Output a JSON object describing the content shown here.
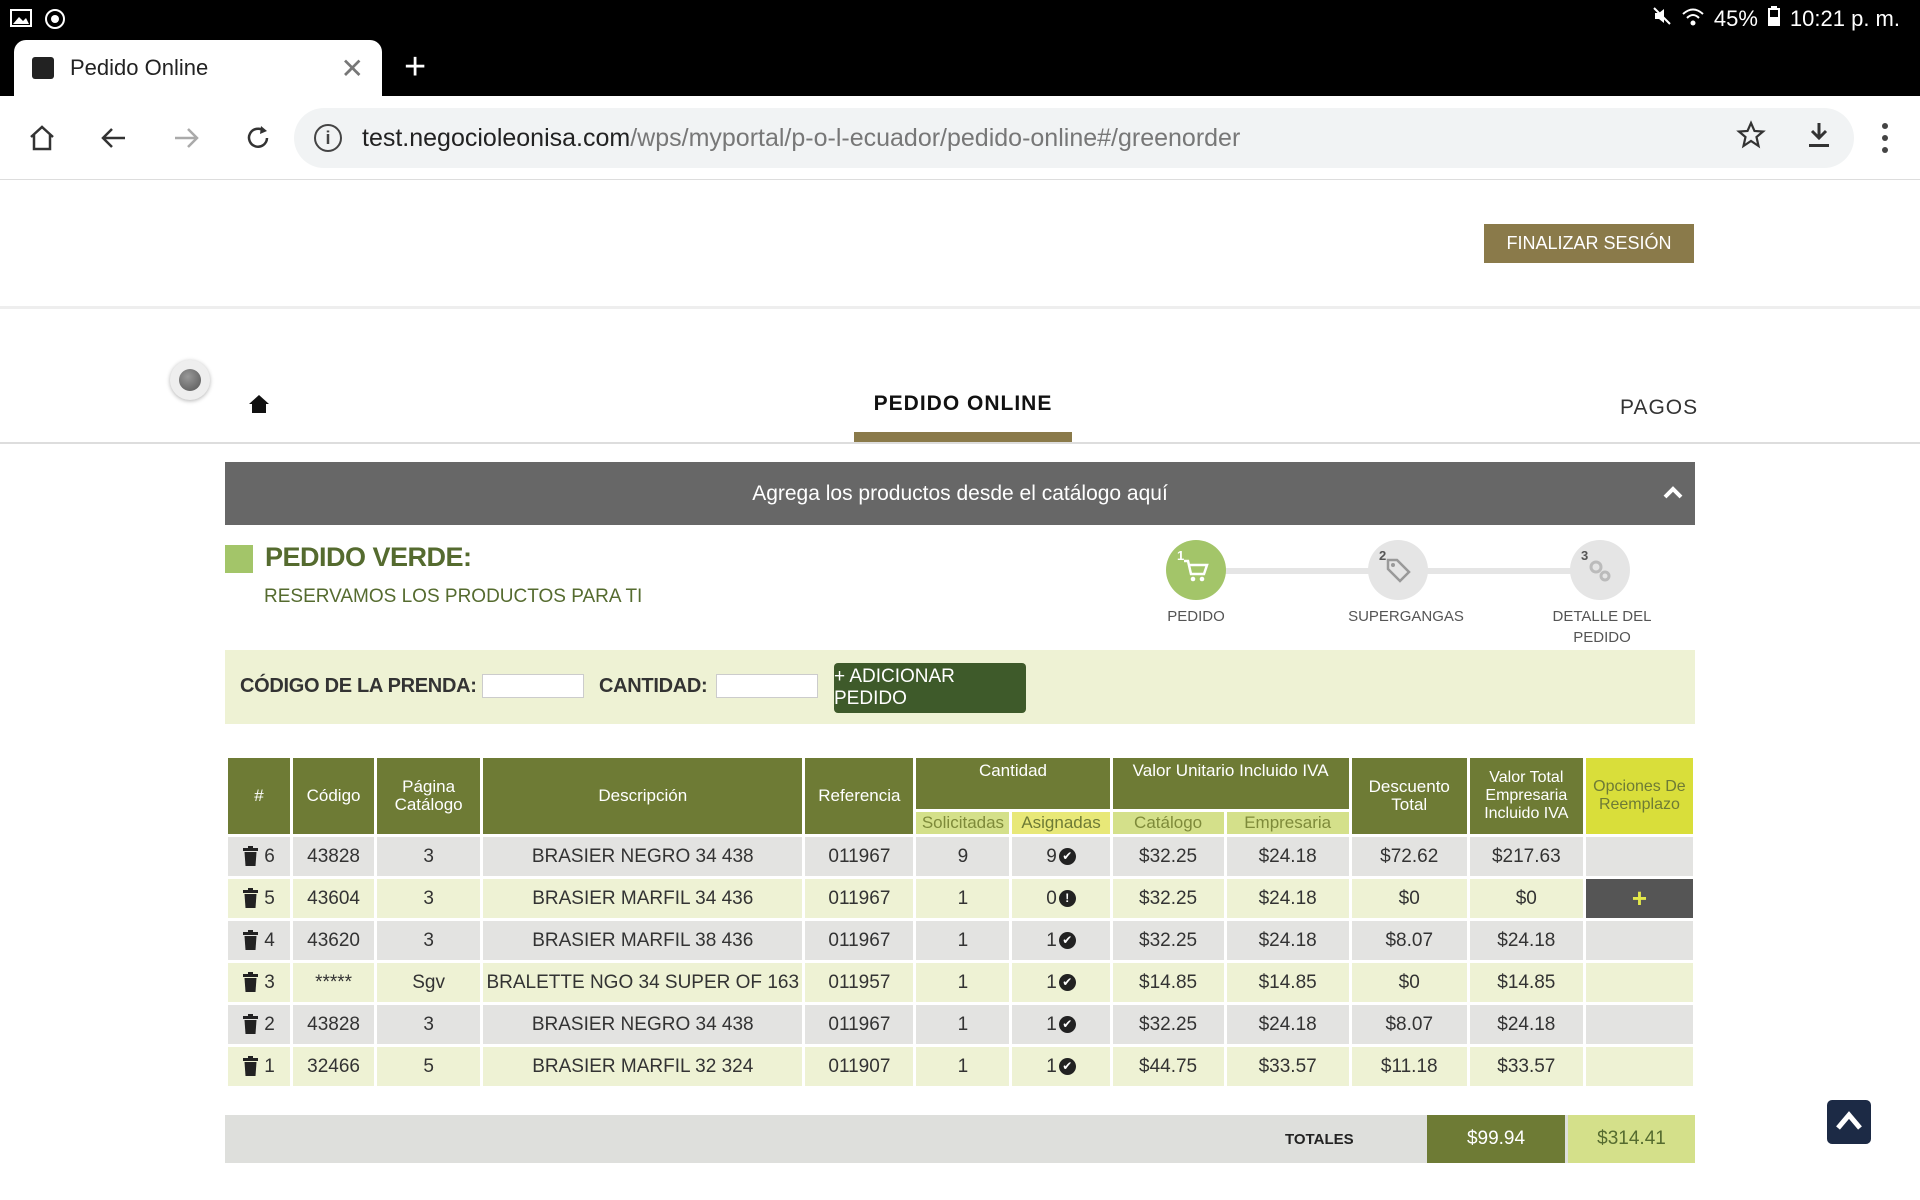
{
  "status_bar": {
    "battery": "45%",
    "time": "10:21 p. m."
  },
  "browser": {
    "tab_title": "Pedido Online",
    "url_host": "test.negocioleonisa.com",
    "url_path": "/wps/myportal/p-o-l-ecuador/pedido-online#/greenorder"
  },
  "header": {
    "logout_label": "FINALIZAR SESIÓN"
  },
  "nav": {
    "pedido_online": "PEDIDO ONLINE",
    "pagos": "PAGOS"
  },
  "catalog_bar": {
    "label": "Agrega los productos desde el catálogo aquí"
  },
  "pedido_verde": {
    "title": "PEDIDO VERDE:",
    "subtitle": "RESERVAMOS LOS PRODUCTOS PARA TI"
  },
  "steps": [
    {
      "num": "1",
      "label": "PEDIDO",
      "active": true
    },
    {
      "num": "2",
      "label": "SUPERGANGAS",
      "active": false
    },
    {
      "num": "3",
      "label": "DETALLE DEL PEDIDO",
      "active": false
    }
  ],
  "add_form": {
    "codigo_label": "CÓDIGO DE LA PRENDA:",
    "codigo_value": "",
    "cantidad_label": "CANTIDAD:",
    "cantidad_value": "",
    "add_button": "+ ADICIONAR PEDIDO"
  },
  "table": {
    "headers": {
      "num": "#",
      "codigo": "Código",
      "pagina": "Página Catálogo",
      "descripcion": "Descripción",
      "referencia": "Referencia",
      "cantidad": "Cantidad",
      "solicitadas": "Solicitadas",
      "asignadas": "Asignadas",
      "valor_unitario": "Valor Unitario Incluido IVA",
      "catalogo": "Catálogo",
      "empresaria": "Empresaria",
      "descuento": "Descuento Total",
      "valor_total": "Valor Total Empresaria Incluido IVA",
      "opciones": "Opciones De Reemplazo"
    },
    "rows": [
      {
        "num": "6",
        "codigo": "43828",
        "pagina": "3",
        "descripcion": "BRASIER NEGRO 34 438",
        "referencia": "011967",
        "solicitadas": "9",
        "asignadas": "9",
        "status": "ok",
        "catalogo": "$32.25",
        "empresaria": "$24.18",
        "descuento": "$72.62",
        "total": "$217.63",
        "opcion": ""
      },
      {
        "num": "5",
        "codigo": "43604",
        "pagina": "3",
        "descripcion": "BRASIER MARFIL 34 436",
        "referencia": "011967",
        "solicitadas": "1",
        "asignadas": "0",
        "status": "warn",
        "catalogo": "$32.25",
        "empresaria": "$24.18",
        "descuento": "$0",
        "total": "$0",
        "opcion": "+"
      },
      {
        "num": "4",
        "codigo": "43620",
        "pagina": "3",
        "descripcion": "BRASIER MARFIL 38 436",
        "referencia": "011967",
        "solicitadas": "1",
        "asignadas": "1",
        "status": "ok",
        "catalogo": "$32.25",
        "empresaria": "$24.18",
        "descuento": "$8.07",
        "total": "$24.18",
        "opcion": ""
      },
      {
        "num": "3",
        "codigo": "*****",
        "pagina": "Sgv",
        "descripcion": "BRALETTE NGO 34 SUPER OF 163",
        "referencia": "011957",
        "solicitadas": "1",
        "asignadas": "1",
        "status": "ok",
        "catalogo": "$14.85",
        "empresaria": "$14.85",
        "descuento": "$0",
        "total": "$14.85",
        "opcion": ""
      },
      {
        "num": "2",
        "codigo": "43828",
        "pagina": "3",
        "descripcion": "BRASIER NEGRO 34 438",
        "referencia": "011967",
        "solicitadas": "1",
        "asignadas": "1",
        "status": "ok",
        "catalogo": "$32.25",
        "empresaria": "$24.18",
        "descuento": "$8.07",
        "total": "$24.18",
        "opcion": ""
      },
      {
        "num": "1",
        "codigo": "32466",
        "pagina": "5",
        "descripcion": "BRASIER MARFIL 32 324",
        "referencia": "011907",
        "solicitadas": "1",
        "asignadas": "1",
        "status": "ok",
        "catalogo": "$44.75",
        "empresaria": "$33.57",
        "descuento": "$11.18",
        "total": "$33.57",
        "opcion": ""
      }
    ]
  },
  "totals": {
    "label": "TOTALES",
    "descuento": "$99.94",
    "valor_total": "$314.41"
  },
  "colors": {
    "olive": "#6e7b35",
    "light_green": "#eef2d4",
    "gold": "#8a7a4a",
    "step_active": "#a3c569"
  }
}
